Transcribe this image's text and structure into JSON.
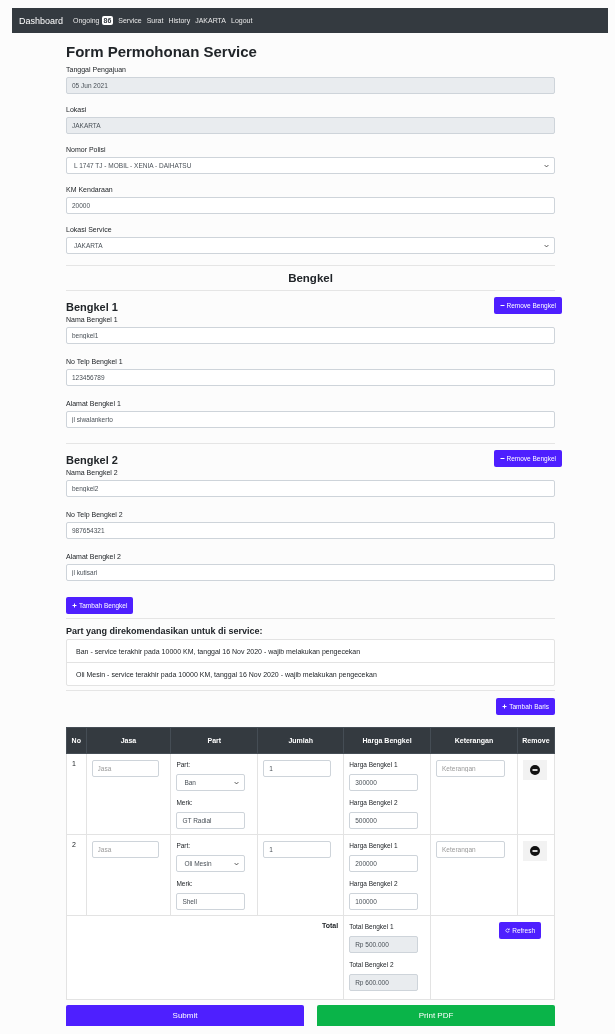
{
  "navbar": {
    "brand": "Dashboard",
    "links": [
      {
        "label": "Ongoing",
        "badge": "86"
      },
      {
        "label": "Service"
      },
      {
        "label": "Surat"
      },
      {
        "label": "History"
      },
      {
        "label": "JAKARTA"
      },
      {
        "label": "Logout"
      }
    ]
  },
  "title": "Form Permohonan Service",
  "fields": [
    {
      "label": "Tanggal Pengajuan",
      "value": "05 Jun 2021",
      "kind": "readonly"
    },
    {
      "label": "Lokasi",
      "value": "JAKARTA",
      "kind": "readonly"
    },
    {
      "label": "Nomor Polisi",
      "value": "L 1747 TJ - MOBIL - XENIA - DAIHATSU",
      "kind": "select"
    },
    {
      "label": "KM Kendaraan",
      "value": "20000",
      "kind": "input"
    },
    {
      "label": "Lokasi Service",
      "value": "JAKARTA",
      "kind": "select"
    }
  ],
  "bengkel_heading": "Bengkel",
  "bengkels": [
    {
      "title": "Bengkel 1",
      "remove_button": "Remove Bengkel",
      "fields": [
        {
          "label": "Nama Bengkel 1",
          "value": "bengkel1"
        },
        {
          "label": "No Telp Bengkel 1",
          "value": "123456789"
        },
        {
          "label": "Alamat Bengkel 1",
          "value": "jl siwalankerto"
        }
      ]
    },
    {
      "title": "Bengkel 2",
      "remove_button": "Remove Bengkel",
      "fields": [
        {
          "label": "Nama Bengkel 2",
          "value": "bengkel2"
        },
        {
          "label": "No Telp Bengkel 2",
          "value": "987654321"
        },
        {
          "label": "Alamat Bengkel 2",
          "value": "jl kutisari"
        }
      ]
    }
  ],
  "add_bengkel_button": "Tambah Bengkel",
  "recommendations": {
    "title": "Part yang direkomendasikan untuk di service:",
    "items": [
      "Ban - service terakhir pada 10000 KM, tanggal 16 Nov 2020 - wajib melakukan pengecekan",
      "Oli Mesin - service terakhir pada 10000 KM, tanggal 16 Nov 2020 - wajib melakukan pengecekan"
    ]
  },
  "add_row_button": "Tambah Baris",
  "table": {
    "columns": [
      "No",
      "Jasa",
      "Part",
      "Jumlah",
      "Harga Bengkel",
      "Keterangan",
      "Remove"
    ],
    "rows": [
      {
        "no": "1",
        "jasa_placeholder": "Jasa",
        "part_label": "Part:",
        "part": "Ban",
        "merk_label": "Merk:",
        "merk": "GT Radial",
        "jumlah": "1",
        "harga": [
          {
            "label": "Harga Bengkel 1",
            "value": "300000"
          },
          {
            "label": "Harga Bengkel 2",
            "value": "500000"
          }
        ],
        "keterangan_placeholder": "Keterangan"
      },
      {
        "no": "2",
        "jasa_placeholder": "Jasa",
        "part_label": "Part:",
        "part": "Oli Mesin",
        "merk_label": "Merk:",
        "merk": "Shell",
        "jumlah": "1",
        "harga": [
          {
            "label": "Harga Bengkel 1",
            "value": "200000"
          },
          {
            "label": "Harga Bengkel 2",
            "value": "100000"
          }
        ],
        "keterangan_placeholder": "Keterangan"
      }
    ],
    "total": {
      "label": "Total",
      "items": [
        {
          "label": "Total Bengkel 1",
          "value": "Rp 500.000"
        },
        {
          "label": "Total Bengkel 2",
          "value": "Rp 600.000"
        }
      ],
      "refresh_button": "Refresh"
    }
  },
  "actions": [
    {
      "label": "Submit",
      "kind": "primary"
    },
    {
      "label": "Print PDF",
      "kind": "success"
    }
  ]
}
